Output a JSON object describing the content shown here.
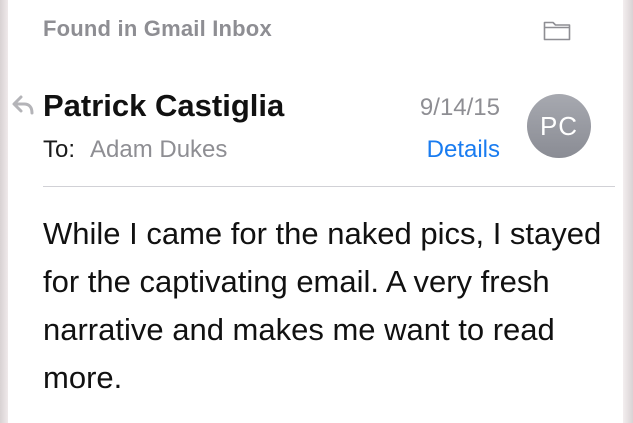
{
  "header": {
    "found_label": "Found in Gmail Inbox",
    "folder_icon": "folder-icon"
  },
  "message": {
    "reply_icon": "reply-arrow-icon",
    "sender": "Patrick Castiglia",
    "to_label": "To:",
    "to_value": "Adam Dukes",
    "date": "9/14/15",
    "details_label": "Details",
    "avatar_initials": "PC",
    "body": "While I came for the naked pics, I stayed for the captivating email. A very fresh narrative and makes me want to read more."
  },
  "colors": {
    "link": "#1a7cf0",
    "secondary_text": "#8e8e93",
    "avatar": "#9a9ca3"
  }
}
